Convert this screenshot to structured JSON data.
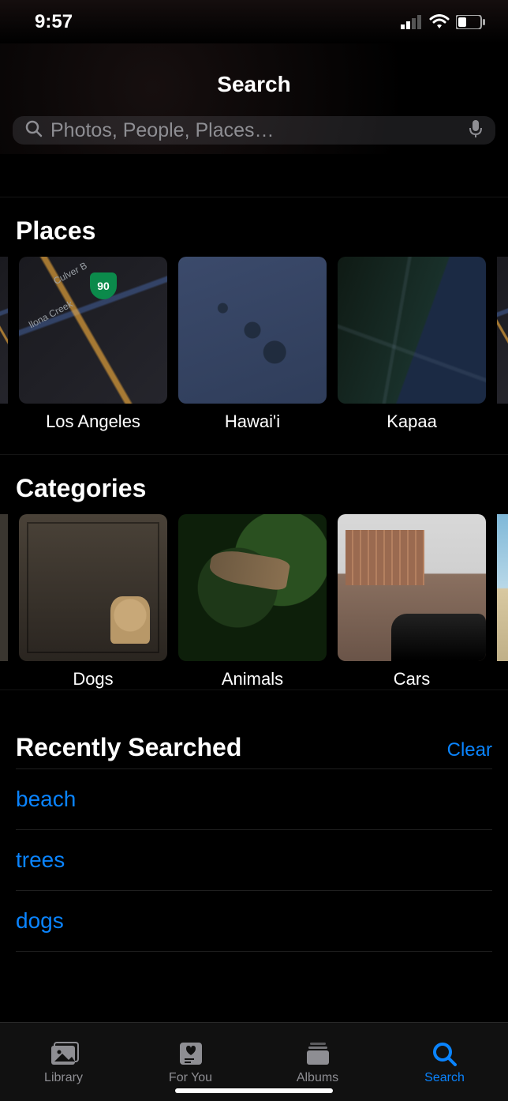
{
  "status": {
    "time": "9:57"
  },
  "header": {
    "title": "Search"
  },
  "search": {
    "placeholder": "Photos, People, Places…",
    "value": ""
  },
  "places": {
    "title": "Places",
    "items": [
      {
        "label": "Los Angeles",
        "map_highway_shield": "90",
        "map_road_label_1": "Culver B",
        "map_road_label_2": "llona Creek"
      },
      {
        "label": "Hawai'i"
      },
      {
        "label": "Kapaa"
      }
    ]
  },
  "categories": {
    "title": "Categories",
    "items": [
      {
        "label": "Dogs"
      },
      {
        "label": "Animals"
      },
      {
        "label": "Cars"
      }
    ]
  },
  "recent": {
    "title": "Recently Searched",
    "clear_label": "Clear",
    "items": [
      "beach",
      "trees",
      "dogs"
    ]
  },
  "tabs": {
    "items": [
      {
        "label": "Library"
      },
      {
        "label": "For You"
      },
      {
        "label": "Albums"
      },
      {
        "label": "Search"
      }
    ],
    "active_index": 3
  },
  "colors": {
    "accent": "#0a84ff"
  }
}
